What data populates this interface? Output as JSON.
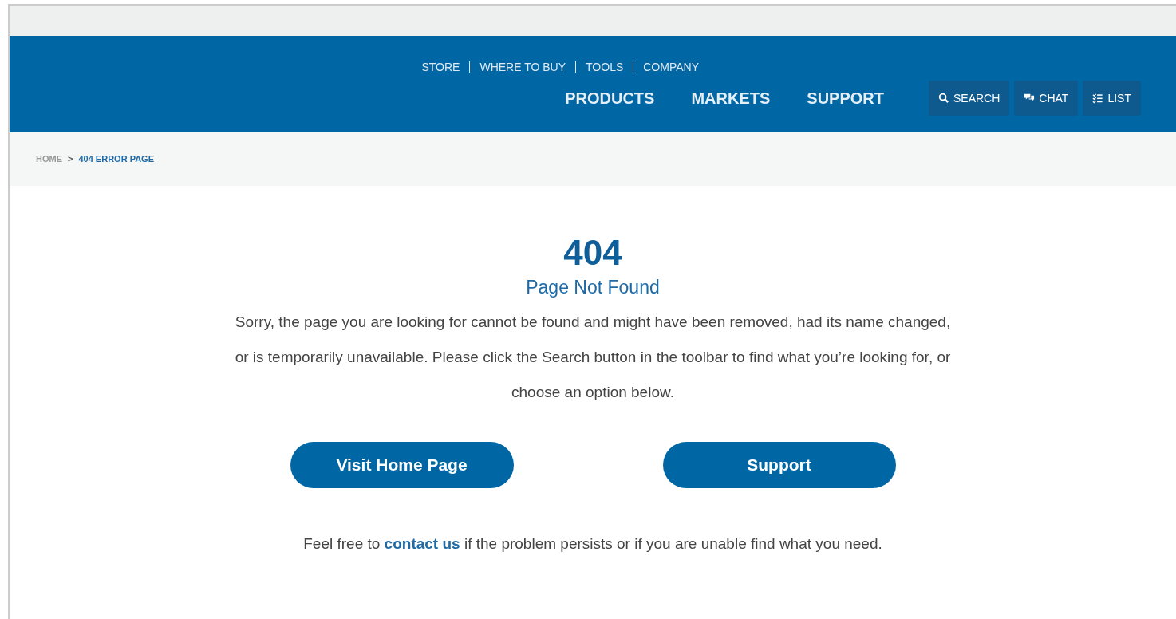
{
  "utility_links": [
    "STORE",
    "WHERE TO BUY",
    "TOOLS",
    "COMPANY"
  ],
  "main_nav": [
    "PRODUCTS",
    "MARKETS",
    "SUPPORT"
  ],
  "toolbar": [
    {
      "kind": "search",
      "label": "SEARCH"
    },
    {
      "kind": "chat",
      "label": "CHAT"
    },
    {
      "kind": "list",
      "label": "LIST"
    }
  ],
  "breadcrumb": {
    "items": [
      "HOME",
      "404 ERROR PAGE"
    ],
    "separator": ">"
  },
  "error": {
    "code": "404",
    "title": "Page Not Found",
    "message": "Sorry, the page you are looking for cannot be found and might have been removed, had its name changed, or is temporarily unavailable. Please click the Search button in the toolbar to find what you’re looking for, or choose an option below.",
    "buttons": [
      "Visit Home Page",
      "Support"
    ],
    "footer_before": "Feel free to",
    "footer_link": "contact us",
    "footer_after": "if the problem persists or if you are unable find what you need."
  }
}
